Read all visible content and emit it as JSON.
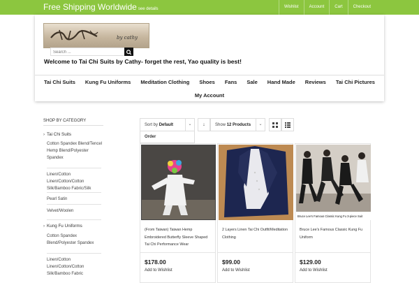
{
  "topbar": {
    "shipping_big": "Free Shipping Worldwide",
    "shipping_small": "see details",
    "links": [
      "Wishlist",
      "Account",
      "Cart",
      "Checkout"
    ]
  },
  "header": {
    "logo_text": "by cathy",
    "search_placeholder": "Search ...",
    "welcome": "Welcome to Tai Chi Suits by Cathy- forget the rest, Yao quality is best!"
  },
  "nav": {
    "row1": [
      "Tai Chi Suits",
      "Kung Fu Uniforms",
      "Meditation Clothing",
      "Shoes",
      "Fans",
      "Sale",
      "Hand Made",
      "Reviews",
      "Tai Chi Pictures"
    ],
    "row2": [
      "My Account"
    ]
  },
  "sidebar": {
    "title": "Shop by Category",
    "categories": [
      {
        "label": "Tai Chi Suits",
        "subs": [
          "Cotton Spandex Blend/Tencel Hemp Blend/Polyester Spandex",
          "Linen/Cotton Linen/Cotton/Cotton Silk/Bamboo Fabric/Silk",
          "Pearl Satin",
          "Velvet/Woolen"
        ]
      },
      {
        "label": "Kung Fu Uniforms",
        "subs": [
          "Cotton Spandex Blend/Polyester Spandex",
          "Linen/Cotton Linen/Cotton/Cotton Silk/Bamboo Fabric"
        ]
      }
    ]
  },
  "toolbar": {
    "sort_prefix": "Sort by",
    "sort_value": "Default",
    "show_prefix": "Show",
    "show_value": "12 Products",
    "order_label": "Order"
  },
  "products": [
    {
      "title": "(From Taiwan) Taiwan Hemp Embroidered Butterfly Sleeve Shaped Tai Chi Performance Wear",
      "price": "$178.00",
      "wishlist": "Add to Wishlist",
      "image_caption": ""
    },
    {
      "title": "2 Layers Linen Tai Chi Outfit/Meditation Clothing",
      "price": "$99.00",
      "wishlist": "Add to Wishlist",
      "image_caption": ""
    },
    {
      "title": "Bruce Lee's Famous Classic Kung Fu Uniform",
      "price": "$129.00",
      "wishlist": "Add to Wishlist",
      "image_caption": "Bruce Lee's Famous Classic Kung Fu 3-piece Suit"
    }
  ],
  "colors": {
    "accent": "#8cc63f",
    "text": "#333333"
  }
}
